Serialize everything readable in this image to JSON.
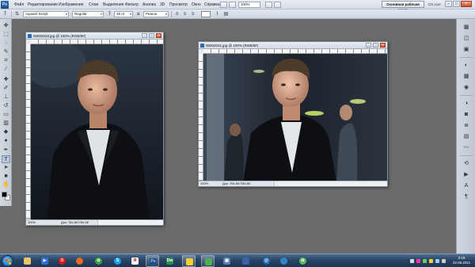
{
  "app": {
    "badge": "Ps"
  },
  "menubar": {
    "items": [
      "Файл",
      "Редактирование",
      "Изображение",
      "Слои",
      "Выделение",
      "Фильтр",
      "Анализ",
      "3D",
      "Просмотр",
      "Окно",
      "Справка"
    ],
    "zoom": "100%",
    "workspace": "Основная рабочая среда",
    "cs_live": "CS Live"
  },
  "options": {
    "font_family": "Aquarel Script",
    "font_style": "Regular",
    "font_size": "48 пт",
    "antialias": "Резкое"
  },
  "documents": [
    {
      "title": "00002033.jpg @ 100% (RGB/8#)",
      "zoom": "100%",
      "doc_info": "Док: 784,6K/784,6K"
    },
    {
      "title": "00002021.jpg @ 100% (RGB/8#)",
      "zoom": "100%",
      "doc_info": "Док: 784,6K/784,6K"
    }
  ],
  "taskbar": {
    "clock_time": "2:18",
    "clock_date": "22.06.2011",
    "lang": "RU"
  }
}
